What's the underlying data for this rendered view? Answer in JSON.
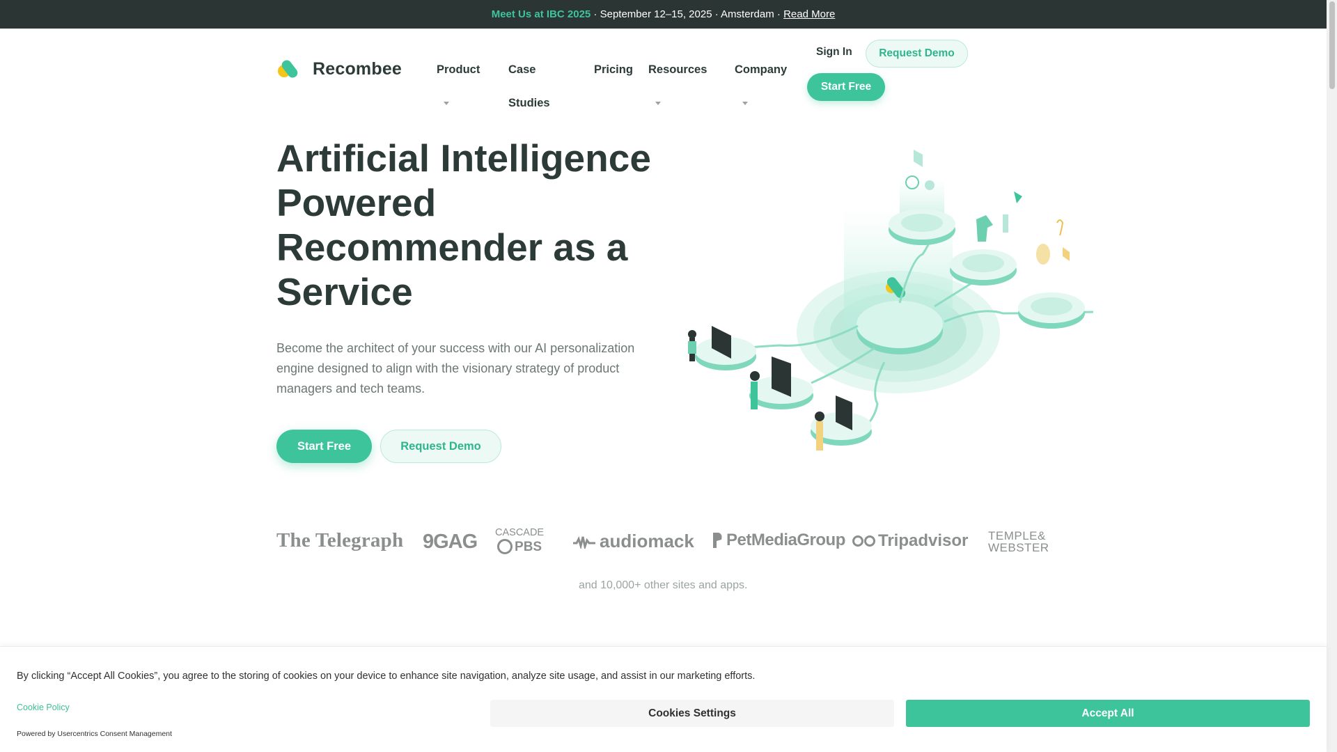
{
  "announcement": {
    "highlight": "Meet Us at IBC 2025",
    "details": " · September 12–15, 2025 · Amsterdam · ",
    "link_label": "Read More"
  },
  "header": {
    "logo_text": "Recombee",
    "nav": {
      "product": "Product",
      "case_line1": "Case",
      "case_line2": "Studies",
      "pricing": "Pricing",
      "resources": "Resources",
      "company": "Company"
    },
    "sign_in": "Sign In",
    "request_demo": "Request Demo",
    "start_free": "Start Free"
  },
  "hero": {
    "title": "Artificial Intelligence Powered Recommender as a Service",
    "subtitle": "Become the architect of your success with our AI personalization engine designed to align with the visionary strategy of product managers and tech teams.",
    "start_free": "Start Free",
    "request_demo": "Request Demo"
  },
  "clients": {
    "logos": {
      "telegraph": "The Telegraph",
      "ninegag": "9GAG",
      "cascade": "CASCADE",
      "pbs": "PBS",
      "audiomack": "audiomack",
      "petmedia": "PetMediaGroup",
      "tripadvisor": "Tripadvisor",
      "temple1": "TEMPLE&",
      "temple2": "WEBSTER"
    },
    "others": "and 10,000+ other sites and apps."
  },
  "cookie": {
    "text": "By clicking “Accept All Cookies”, you agree to the storing of cookies on your device to enhance site navigation, analyze site usage, and assist in our marketing efforts.",
    "policy": "Cookie Policy",
    "powered": "Powered by Usercentrics Consent Management",
    "settings": "Cookies Settings",
    "accept": "Accept All"
  },
  "colors": {
    "brand_green": "#3ec49b",
    "dark_text": "#2c3a38",
    "announcement_bg": "#2b3533",
    "logo_yellow": "#f5c518"
  }
}
